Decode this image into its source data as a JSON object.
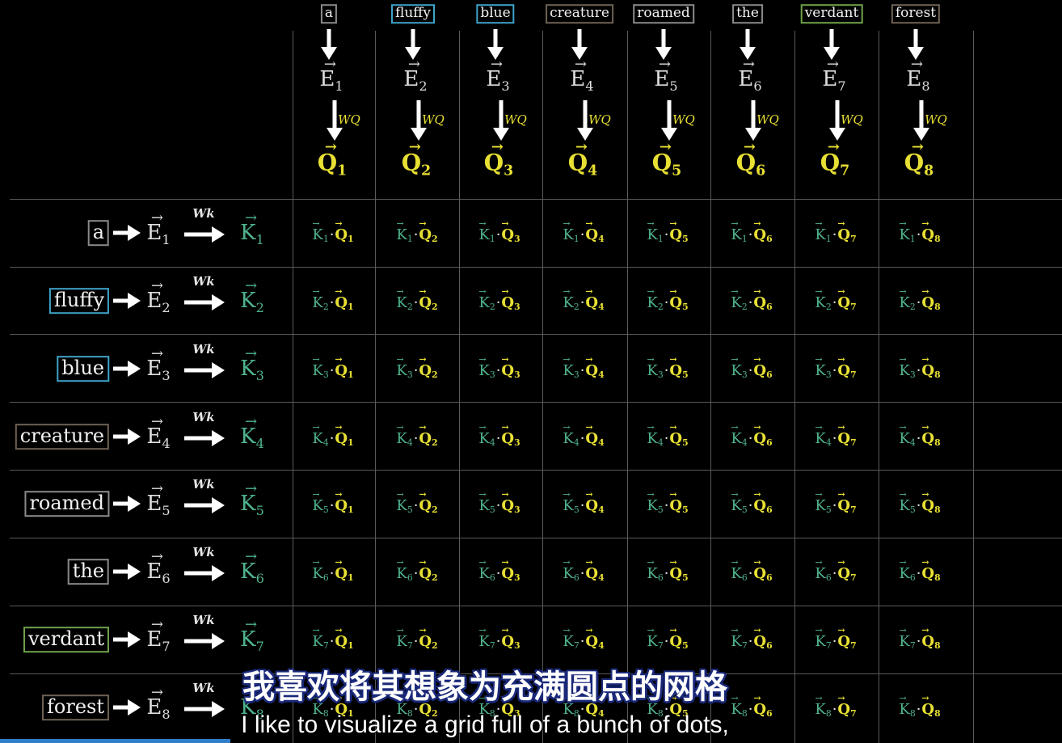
{
  "tokens": [
    {
      "word": "a",
      "color": "#8a8a8a",
      "index": "1"
    },
    {
      "word": "fluffy",
      "color": "#3fa3c8",
      "index": "2"
    },
    {
      "word": "blue",
      "color": "#3fa3c8",
      "index": "3"
    },
    {
      "word": "creature",
      "color": "#6e6254",
      "index": "4"
    },
    {
      "word": "roamed",
      "color": "#8a8a8a",
      "index": "5"
    },
    {
      "word": "the",
      "color": "#8a8a8a",
      "index": "6"
    },
    {
      "word": "verdant",
      "color": "#6fa24a",
      "index": "7"
    },
    {
      "word": "forest",
      "color": "#6e6254",
      "index": "8"
    }
  ],
  "symbols": {
    "embedding": "E",
    "query": "Q",
    "key": "K",
    "vector_arrow": "⃗",
    "dot": "·"
  },
  "weights": {
    "query_label": "WQ",
    "key_label": "Wk"
  },
  "colors": {
    "background": "#000000",
    "grid_line": "#5a5a5a",
    "query": "#e8e033",
    "key": "#4fb38c",
    "embedding": "#dedede"
  },
  "subtitles": {
    "chinese": "我喜欢将其想象为充满圆点的网格",
    "english": "I like to visualize a grid full of a bunch of dots,"
  }
}
